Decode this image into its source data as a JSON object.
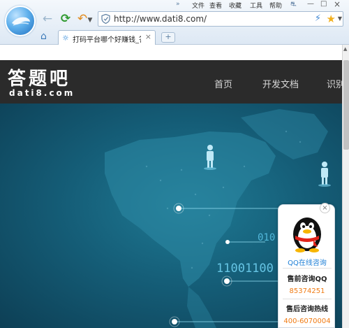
{
  "browser": {
    "menu": {
      "more": "»",
      "file": "文件",
      "view": "查看",
      "favorites": "收藏",
      "tools": "工具",
      "help": "帮助"
    },
    "address_url": "http://www.dati8.com/",
    "tab_title": "打码平台哪个好赚钱_答题",
    "newtab_label": "+",
    "accent": "#1e7fd6"
  },
  "site": {
    "logo_cn": "答题吧",
    "logo_en": "dati8.com",
    "nav": [
      "首页",
      "开发文档",
      "识别"
    ]
  },
  "hero": {
    "binary_1": "010",
    "binary_2": "11001100"
  },
  "qq_panel": {
    "consult_label": "QQ在线咨询",
    "presale_label": "售前咨询QQ",
    "presale_qq": "85374251",
    "aftersale_label": "售后咨询热线",
    "aftersale_phone": "400-6070004",
    "accent_color": "#f07b13"
  }
}
